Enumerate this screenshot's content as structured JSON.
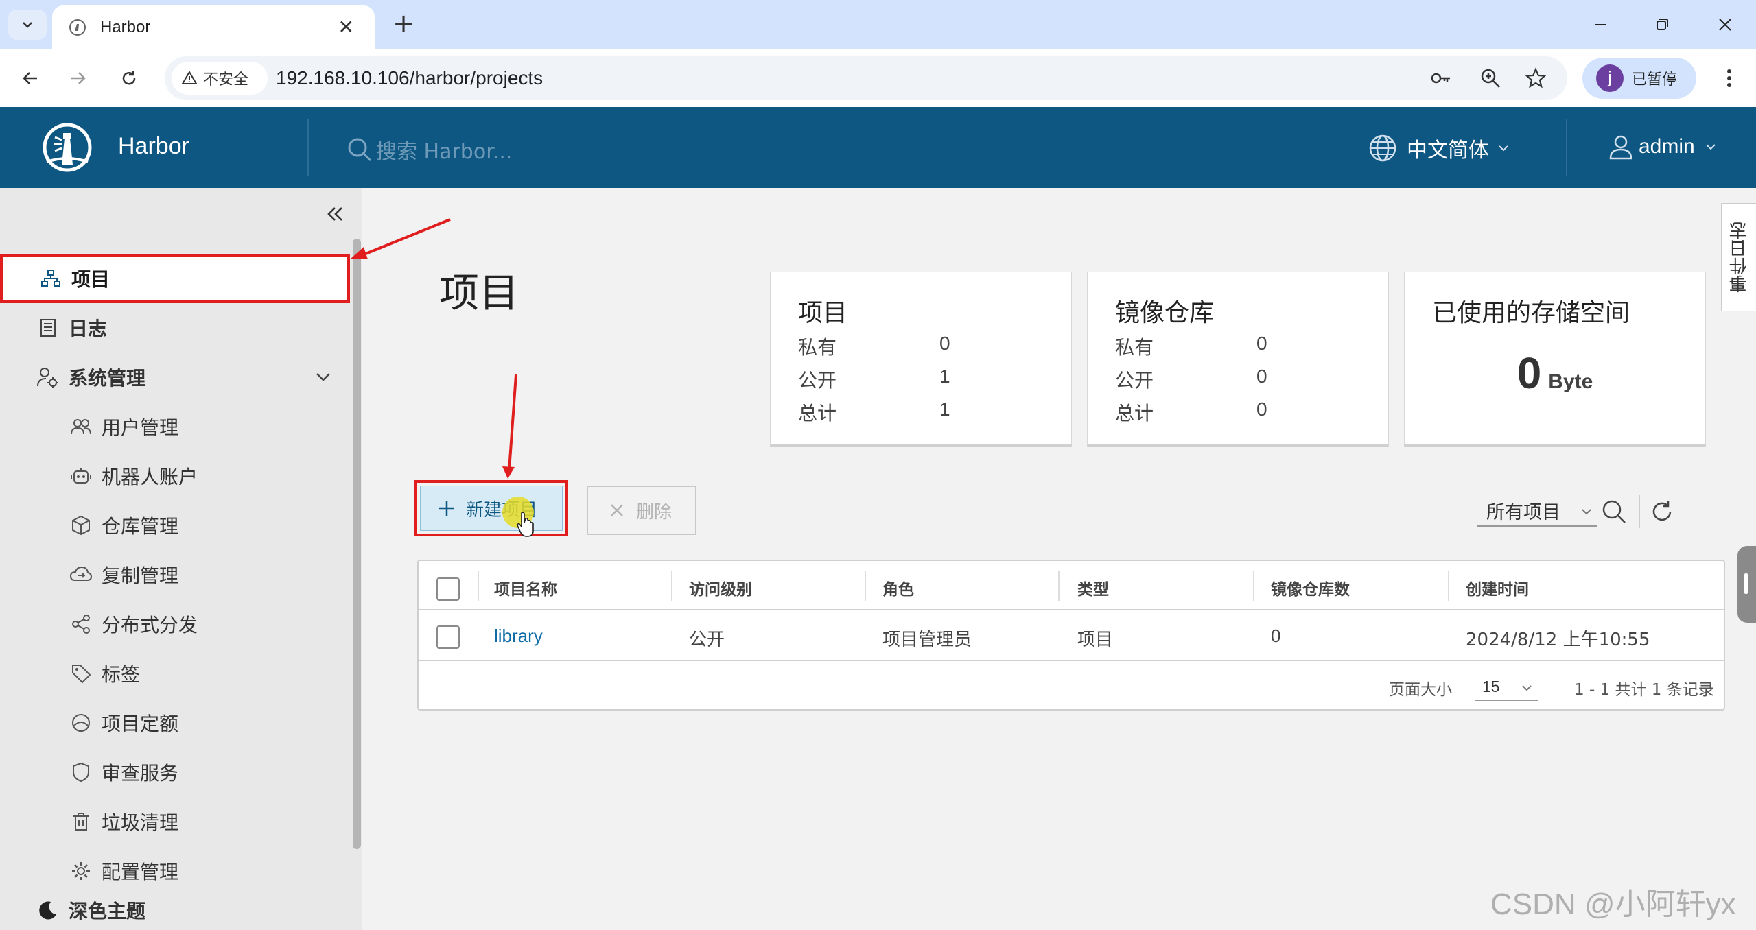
{
  "browser": {
    "tab_title": "Harbor",
    "security_label": "不安全",
    "url": "192.168.10.106/harbor/projects",
    "profile_initial": "j",
    "profile_status": "已暂停"
  },
  "header": {
    "brand": "Harbor",
    "search_placeholder": "搜索 Harbor...",
    "language": "中文简体",
    "user": "admin"
  },
  "sidebar": {
    "items": [
      {
        "label": "项目"
      },
      {
        "label": "日志"
      },
      {
        "label": "系统管理"
      }
    ],
    "admin_items": [
      {
        "label": "用户管理"
      },
      {
        "label": "机器人账户"
      },
      {
        "label": "仓库管理"
      },
      {
        "label": "复制管理"
      },
      {
        "label": "分布式分发"
      },
      {
        "label": "标签"
      },
      {
        "label": "项目定额"
      },
      {
        "label": "审查服务"
      },
      {
        "label": "垃圾清理"
      },
      {
        "label": "配置管理"
      }
    ],
    "theme_label": "深色主题"
  },
  "main": {
    "title": "项目",
    "cards": {
      "projects": {
        "title": "项目",
        "private_label": "私有",
        "private": "0",
        "public_label": "公开",
        "public": "1",
        "total_label": "总计",
        "total": "1"
      },
      "repos": {
        "title": "镜像仓库",
        "private_label": "私有",
        "private": "0",
        "public_label": "公开",
        "public": "0",
        "total_label": "总计",
        "total": "0"
      },
      "storage": {
        "title": "已使用的存储空间",
        "value": "0",
        "unit": "Byte"
      }
    },
    "new_project_label": "新建项目",
    "delete_label": "删除",
    "filter_value": "所有项目",
    "table": {
      "columns": [
        "项目名称",
        "访问级别",
        "角色",
        "类型",
        "镜像仓库数",
        "创建时间"
      ],
      "rows": [
        {
          "name": "library",
          "access": "公开",
          "role": "项目管理员",
          "type": "项目",
          "repo_count": "0",
          "created": "2024/8/12 上午10:55"
        }
      ],
      "page_size_label": "页面大小",
      "page_size": "15",
      "pager_info": "1 - 1 共计 1 条记录"
    },
    "event_log_label": "事件日志"
  },
  "watermark": "CSDN @小阿轩yx",
  "colors": {
    "header_bg": "#0e5783",
    "sidebar_bg": "#e8e8e8",
    "link": "#0e6ba8",
    "annotation_red": "#e01e1e"
  }
}
